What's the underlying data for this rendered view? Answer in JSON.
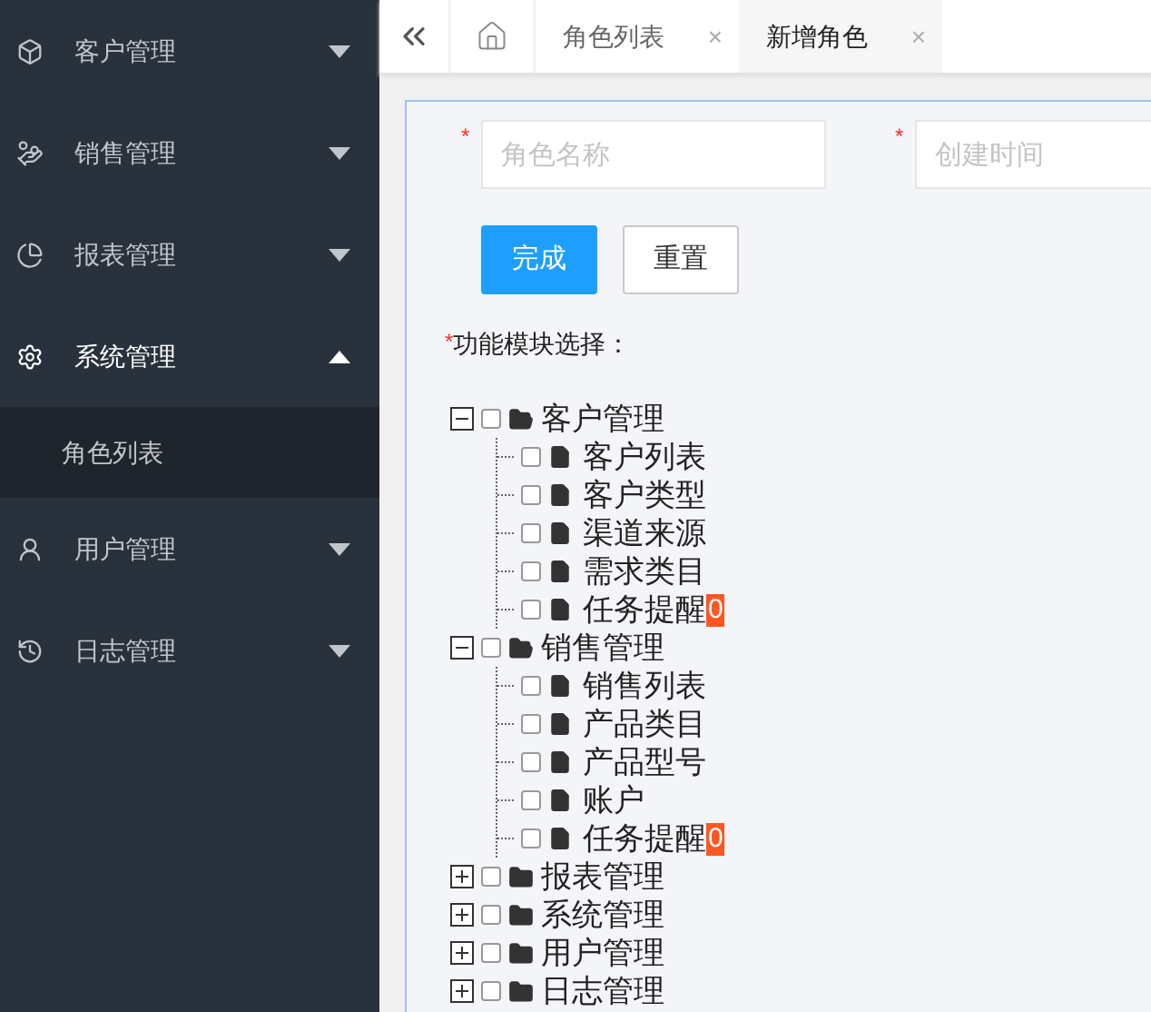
{
  "sidebar": {
    "items": [
      {
        "label": "客户管理",
        "expanded": false
      },
      {
        "label": "销售管理",
        "expanded": false
      },
      {
        "label": "报表管理",
        "expanded": false
      },
      {
        "label": "系统管理",
        "expanded": true,
        "children": [
          {
            "label": "角色列表"
          }
        ]
      },
      {
        "label": "用户管理",
        "expanded": false
      },
      {
        "label": "日志管理",
        "expanded": false
      }
    ]
  },
  "tabs": [
    {
      "label": "角色列表",
      "selected": false,
      "close": "×"
    },
    {
      "label": "新增角色",
      "selected": true,
      "close": "×"
    }
  ],
  "form": {
    "fields": [
      {
        "placeholder": "角色名称",
        "required_mark": "*"
      },
      {
        "placeholder": "创建时间",
        "required_mark": "*"
      }
    ],
    "buttons": [
      {
        "label": "完成",
        "kind": "primary"
      },
      {
        "label": "重置",
        "kind": "default"
      }
    ],
    "tree_label": "功能模块选择：",
    "tree_required_mark": "*"
  },
  "tree": [
    {
      "label": "客户管理",
      "expanded": true,
      "checked": false,
      "children": [
        {
          "label": "客户列表",
          "checked": false
        },
        {
          "label": "客户类型",
          "checked": false
        },
        {
          "label": "渠道来源",
          "checked": false
        },
        {
          "label": "需求类目",
          "checked": false
        },
        {
          "label": "任务提醒",
          "checked": false,
          "badge": "0"
        }
      ]
    },
    {
      "label": "销售管理",
      "expanded": true,
      "checked": false,
      "children": [
        {
          "label": "销售列表",
          "checked": false
        },
        {
          "label": "产品类目",
          "checked": false
        },
        {
          "label": "产品型号",
          "checked": false
        },
        {
          "label": "账户",
          "checked": false
        },
        {
          "label": "任务提醒",
          "checked": false,
          "badge": "0"
        }
      ]
    },
    {
      "label": "报表管理",
      "expanded": false,
      "checked": false
    },
    {
      "label": "系统管理",
      "expanded": false,
      "checked": false
    },
    {
      "label": "用户管理",
      "expanded": false,
      "checked": false
    },
    {
      "label": "日志管理",
      "expanded": false,
      "checked": false
    }
  ]
}
